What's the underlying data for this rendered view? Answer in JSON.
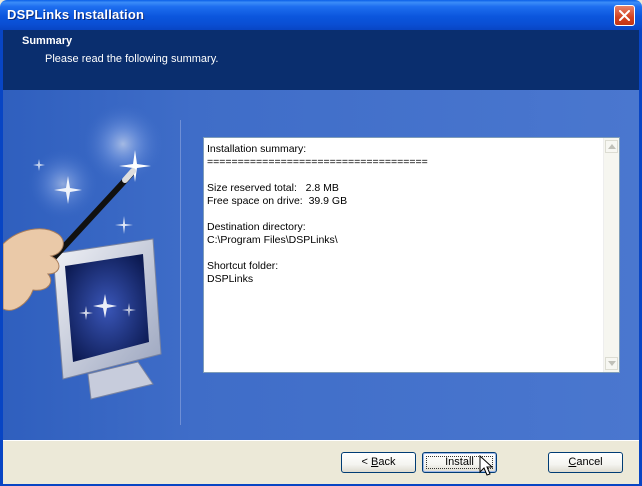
{
  "window": {
    "title": "DSPLinks Installation"
  },
  "header": {
    "title": "Summary",
    "subtitle": "Please read the following summary."
  },
  "summary": {
    "heading": "Installation summary:",
    "separator": "====================================",
    "size_label": "Size reserved total:",
    "size_value": "2.8 MB",
    "free_label": "Free space on drive:",
    "free_value": "39.9 GB",
    "dest_label": "Destination directory:",
    "dest_value": "C:\\Program Files\\DSPLinks\\",
    "shortcut_label": "Shortcut folder:",
    "shortcut_value": "DSPLinks"
  },
  "buttons": {
    "back_mnemonic": "B",
    "back_rest": "ack",
    "back_prefix": "< ",
    "install": "Install",
    "cancel_mnemonic": "C",
    "cancel_rest": "ancel"
  },
  "colors": {
    "title_bar": "#0a56dd",
    "header_bg": "#0a2e6e",
    "body_bg": "#3f6dc8",
    "footer_bg": "#ece9d8"
  },
  "icons": [
    "close-icon",
    "wizard-wand-monitor-illustration",
    "scroll-up-icon",
    "scroll-down-icon",
    "mouse-cursor-icon"
  ]
}
